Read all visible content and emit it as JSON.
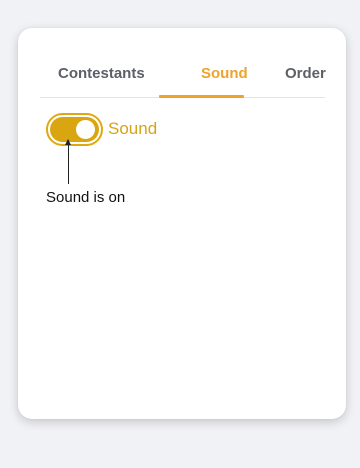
{
  "tabs": [
    {
      "label": "Contestants",
      "active": false
    },
    {
      "label": "Sound",
      "active": true
    },
    {
      "label": "Order",
      "active": false
    }
  ],
  "sound_toggle": {
    "label": "Sound",
    "state": "on"
  },
  "annotation": {
    "text": "Sound is on"
  },
  "colors": {
    "page_background": "#f1f2f6",
    "active_tab": "#f0a22a",
    "inactive_tab": "#5e6068",
    "toggle_on": "#d9a612",
    "toggle_label": "#d6a414"
  }
}
